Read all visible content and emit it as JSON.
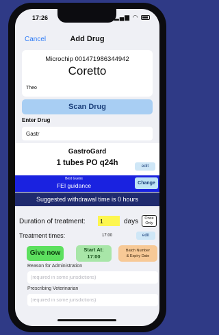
{
  "status_bar": {
    "time": "17:26",
    "signal": "▂▄▆",
    "wifi": "◠"
  },
  "nav": {
    "cancel_label": "Cancel",
    "title": "Add Drug"
  },
  "animal": {
    "microchip": "Microchip 001471986344942",
    "name": "Coretto",
    "owner": "Theo"
  },
  "scan_button": "Scan Drug",
  "enter_drug": {
    "label": "Enter Drug",
    "value": "Gastr"
  },
  "product": {
    "name": "GastroGard",
    "dose": "1 tubes PO q24h",
    "edit_label": "edit"
  },
  "guidance": {
    "best_guess": "Best Guess",
    "text": "FEI guidance",
    "change_label": "Change"
  },
  "withdrawal": {
    "text": "Suggested withdrawal time is 0 hours"
  },
  "duration": {
    "label": "Duration of treatment:",
    "value": "1",
    "unit": "days",
    "once_line1": "Once",
    "once_line2": "Only"
  },
  "times": {
    "label": "Treatment times:",
    "value": "17:00",
    "edit_label": "edit"
  },
  "actions": {
    "give_now": "Give now",
    "start_at_line1": "Start At:",
    "start_at_line2": "17:00",
    "batch_line1": "Batch Number",
    "batch_line2": "& Expiry Date"
  },
  "reason": {
    "label": "Reason for Administration",
    "placeholder": "(required in some jurisdictions)"
  },
  "vet": {
    "label": "Prescribing Veterinarian",
    "placeholder": "(required in some jurisdictions)"
  },
  "colors": {
    "background": "#2f3a86",
    "accent": "#2f7cf6",
    "guidance_bar": "#1a22e0",
    "withdrawal_bar": "#1f2a6e",
    "give_now": "#5de05f",
    "start_at": "#a8e6a8",
    "batch": "#f7c996",
    "duration_highlight": "#fdf64f"
  }
}
